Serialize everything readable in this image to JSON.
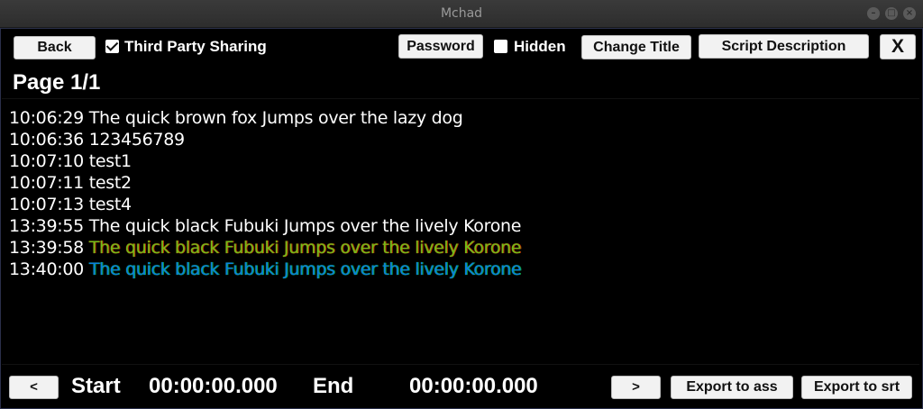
{
  "window": {
    "title": "Mchad"
  },
  "toolbar": {
    "back_label": "Back",
    "third_party_label": "Third Party Sharing",
    "third_party_checked": true,
    "password_label": "Password",
    "hidden_label": "Hidden",
    "hidden_checked": false,
    "change_title_label": "Change Title",
    "script_description_label": "Script Description",
    "close_label": "X"
  },
  "page": {
    "label": "Page 1/1"
  },
  "entries": [
    {
      "time": "10:06:29",
      "text": "The quick brown fox Jumps over the lazy dog",
      "style": "white"
    },
    {
      "time": "10:06:36",
      "text": "123456789",
      "style": "white"
    },
    {
      "time": "10:07:10",
      "text": "test1",
      "style": "white"
    },
    {
      "time": "10:07:11",
      "text": "test2",
      "style": "white"
    },
    {
      "time": "10:07:13",
      "text": "test4",
      "style": "white"
    },
    {
      "time": "13:39:55",
      "text": "The quick black Fubuki Jumps over the lively Korone",
      "style": "white"
    },
    {
      "time": "13:39:58",
      "text": "The quick black Fubuki Jumps over the lively Korone",
      "style": "green"
    },
    {
      "time": "13:40:00",
      "text": "The quick black Fubuki Jumps over the lively Korone",
      "style": "blue"
    }
  ],
  "footer": {
    "prev_label": "<",
    "start_label": "Start",
    "start_time": "00:00:00.000",
    "end_label": "End",
    "end_time": "00:00:00.000",
    "next_label": ">",
    "export_ass_label": "Export to ass",
    "export_srt_label": "Export to srt"
  },
  "colors": {
    "green_text": "#6fbf1a",
    "green_outline": "#d63b00",
    "blue_text": "#0a7ee0",
    "blue_outline": "#11b84a"
  }
}
